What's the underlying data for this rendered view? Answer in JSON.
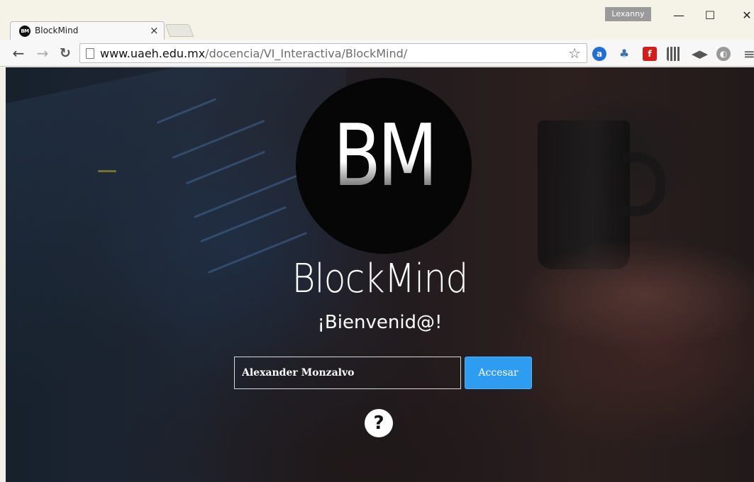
{
  "browser": {
    "tab_title": "BlockMind",
    "tab_favicon": "BM",
    "tab_close": "×",
    "profile_name": "Lexanny",
    "url_host": "www.uaeh.edu.mx",
    "url_path": "/docencia/VI_Interactiva/BlockMind/",
    "icons": [
      "back-icon",
      "forward-icon",
      "reload-icon",
      "star-icon",
      "amazon-extension-icon",
      "sitemap-extension-icon",
      "flipboard-extension-icon",
      "qr-extension-icon",
      "audio-extension-icon",
      "ghostery-extension-icon",
      "menu-icon"
    ]
  },
  "page": {
    "logo_text": "BM",
    "title": "BlockMind",
    "welcome": "¡Bienvenid@!",
    "name_input_value": "Alexander Monzalvo",
    "access_button": "Accesar",
    "help_symbol": "?"
  },
  "colors": {
    "accent_button": "#2e9df1",
    "logo_background": "#060606"
  }
}
